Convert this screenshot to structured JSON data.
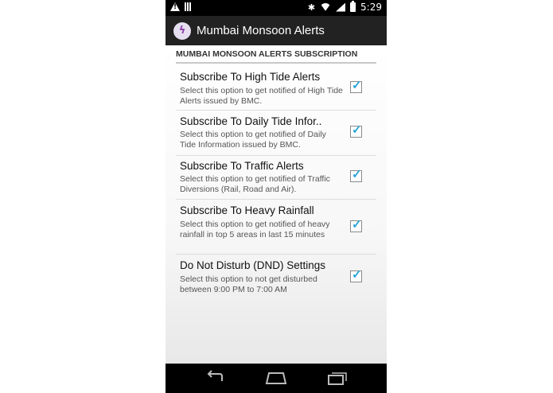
{
  "status_bar": {
    "time": "5:29",
    "icons": [
      "warning-icon",
      "barcode-icon",
      "bluetooth-icon",
      "wifi-icon",
      "signal-icon",
      "battery-icon"
    ]
  },
  "action_bar": {
    "title": "Mumbai Monsoon Alerts",
    "icon": "app-logo-icon"
  },
  "section": {
    "header": "MUMBAI MONSOON ALERTS SUBSCRIPTION"
  },
  "preferences": [
    {
      "title": "Subscribe To High Tide Alerts",
      "summary": "Select this option to get notified of High Tide Alerts issued by BMC.",
      "checked": true
    },
    {
      "title": "Subscribe To Daily Tide Infor..",
      "summary": "Select this option to get notified of Daily Tide Information issued by BMC.",
      "checked": true
    },
    {
      "title": "Subscribe To Traffic Alerts",
      "summary": "Select this option to get notified of Traffic Diversions (Rail, Road and Air).",
      "checked": true
    },
    {
      "title": "Subscribe To Heavy Rainfall",
      "summary": "Select this option to get notified of heavy rainfall in top 5 areas in last 15 minutes",
      "checked": true
    },
    {
      "title": "Do Not Disturb (DND) Settings",
      "summary": "Select this option to not get disturbed between 9:00 PM to 7:00 AM",
      "checked": true
    }
  ],
  "nav_bar": {
    "buttons": [
      "back-icon",
      "home-icon",
      "recents-icon"
    ]
  },
  "colors": {
    "action_bar": "#222222",
    "checkmark": "#2aa6d8",
    "status_bar": "#000000"
  }
}
